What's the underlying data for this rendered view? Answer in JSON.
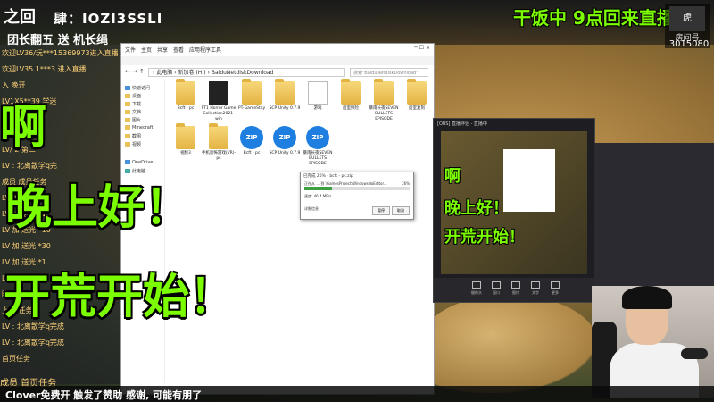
{
  "banner": {
    "ticker": "肆：IOZI3SSLI",
    "ticker2": "团长翻五  送  机长绳",
    "headline": "干饭中 9点回来直播！",
    "room_label": "房间号",
    "room_id": "3015080"
  },
  "chat": {
    "lines": [
      "欢迎LV36/玩***15369973进入直播",
      "欢迎LV35 1***3 进入直播",
      "入  晚开",
      "LV1X5**39 学迷",
      "LV  : 今天玩什",
      "LV4  : 篇呆",
      "LV/ 2   第二",
      "LV   :  北离散学q完",
      "成员  成员任务",
      "LV  加  送卡  *60",
      "LV  加  送光  *1",
      "LV  加  送光  *10",
      "LV  加  送光  *30",
      "LV  加  送光  *1",
      "LV  加  送光  *1",
      "晓开  战斗",
      "上线  任务",
      "LV  :  北离散学q完成",
      "LV  :  北离散学q完成",
      "首页任务"
    ]
  },
  "overlay_text": {
    "line1": "啊",
    "line2": "晚上好！",
    "line3": "开荒开始！"
  },
  "explorer": {
    "tabs": [
      "文件",
      "主页",
      "共享",
      "查看",
      "应用程序工具"
    ],
    "controls": "─  ☐  ✕",
    "address": "› 此电脑 › 新加卷 (H:) › BaiduNetdiskDownload",
    "search_placeholder": "搜索\"BaiduNetdiskDownload\"",
    "sidebar": [
      {
        "label": "快速访问",
        "type": "star"
      },
      {
        "label": "桌面",
        "type": "folder"
      },
      {
        "label": "下载",
        "type": "folder"
      },
      {
        "label": "文档",
        "type": "folder"
      },
      {
        "label": "图片",
        "type": "folder"
      },
      {
        "label": "Minecraft",
        "type": "folder"
      },
      {
        "label": "截图",
        "type": "folder"
      },
      {
        "label": "视频",
        "type": "folder"
      },
      {
        "label": "OneDrive",
        "type": "cloud"
      },
      {
        "label": "此电脑",
        "type": "pc"
      }
    ],
    "files_row1": [
      {
        "label": "Bcft - pc",
        "type": "folder"
      },
      {
        "label": "PT1 Horror Game Collection2021-win",
        "type": "dark"
      },
      {
        "label": "PT-GameStay",
        "type": "folder"
      },
      {
        "label": "SCP Unity 0.7.9",
        "type": "folder"
      },
      {
        "label": "游戏",
        "type": "doc"
      },
      {
        "label": "后室探险",
        "type": "folder"
      },
      {
        "label": "暴雨长夜SEVEN BULLETS EPISODE",
        "type": "folder"
      },
      {
        "label": "后室复刻",
        "type": "folder"
      }
    ],
    "files_row2": [
      {
        "label": "视频3",
        "type": "folder"
      },
      {
        "label": "手机恐怖游戏(VR)-pc",
        "type": "folder"
      },
      {
        "label": "Bcft - pc",
        "type": "zip"
      },
      {
        "label": "SCP Unity 0.7.9",
        "type": "zip"
      },
      {
        "label": "暴雨长夜SEVEN BULLETS EPISODE",
        "type": "zip"
      }
    ]
  },
  "copy_dialog": {
    "title": "已完成 26% - bcft - pc.zip",
    "line": "正在从 ... 到 \\GamesProject\\WindowsNoEditor...",
    "percent": "26%",
    "progress": 0.26,
    "speed": "速度: 46.4 MB/s",
    "more": "详细信息",
    "pause": "暂停",
    "cancel": "取消"
  },
  "obs": {
    "title": "[OBS] 直播伴侣 - 直播中",
    "small_text1": "啊",
    "small_text2": "晚上好！",
    "small_text3": "开荒开始！",
    "tools": [
      "摄像头",
      "窗口",
      "图片",
      "文字",
      "更多"
    ]
  },
  "bottom": {
    "text": "Clover免费开 触发了赞助  感谢, 可能有朋了",
    "overlay": "成员 首页任务"
  },
  "colors": {
    "accent_green": "#7CFC00",
    "chat_yellow": "#ffd27a",
    "zip_blue": "#1e7fe0",
    "progress_green": "#3aa040"
  }
}
